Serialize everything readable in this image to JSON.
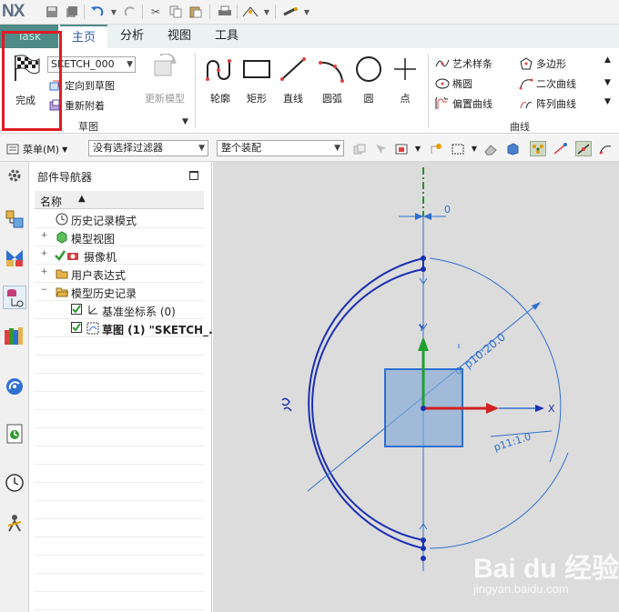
{
  "app": {
    "logo": "NX"
  },
  "tabs": {
    "task": "Task",
    "home": "主页",
    "analysis": "分析",
    "view": "视图",
    "tools": "工具"
  },
  "sketch_group": {
    "finish_label": "完成",
    "sketch_name": "SKETCH_000",
    "orient_label": "定向到草图",
    "reattach_label": "重新附着",
    "update_model_label": "更新模型",
    "group_label": "草图"
  },
  "curve_tools": {
    "profile": "轮廓",
    "rectangle": "矩形",
    "line": "直线",
    "arc": "圆弧",
    "circle": "圆",
    "point": "点"
  },
  "curve_small": {
    "studio_spline": "艺术样条",
    "ellipse": "椭圆",
    "offset_curve": "偏置曲线",
    "polygon": "多边形",
    "conic": "二次曲线",
    "pattern_curve": "阵列曲线",
    "group_label": "曲线"
  },
  "selection_bar": {
    "menu_label": "菜单(M)",
    "filter": "没有选择过滤器",
    "scope": "整个装配"
  },
  "navigator": {
    "title": "部件导航器",
    "column_name": "名称",
    "items": [
      {
        "label": "历史记录模式"
      },
      {
        "label": "模型视图"
      },
      {
        "label": "摄像机"
      },
      {
        "label": "用户表达式"
      },
      {
        "label": "模型历史记录"
      },
      {
        "label": "基准坐标系 (0)"
      },
      {
        "label": "草图 (1) \"SKETCH_..."
      }
    ]
  },
  "canvas": {
    "dim_zero": "0",
    "dim_diameter": "Φ p10:20.0",
    "dim_p11": "p11:1.0",
    "axis_x": "X",
    "axis_y": "Y",
    "colors": {
      "curve": "#1b2fb3",
      "dim": "#2f6fd0",
      "x_axis": "#d02020",
      "y_axis": "#20a030",
      "center": "#2e8b2e"
    }
  },
  "watermark": {
    "main": "Bai du 经验",
    "sub": "jingyan.baidu.com"
  }
}
